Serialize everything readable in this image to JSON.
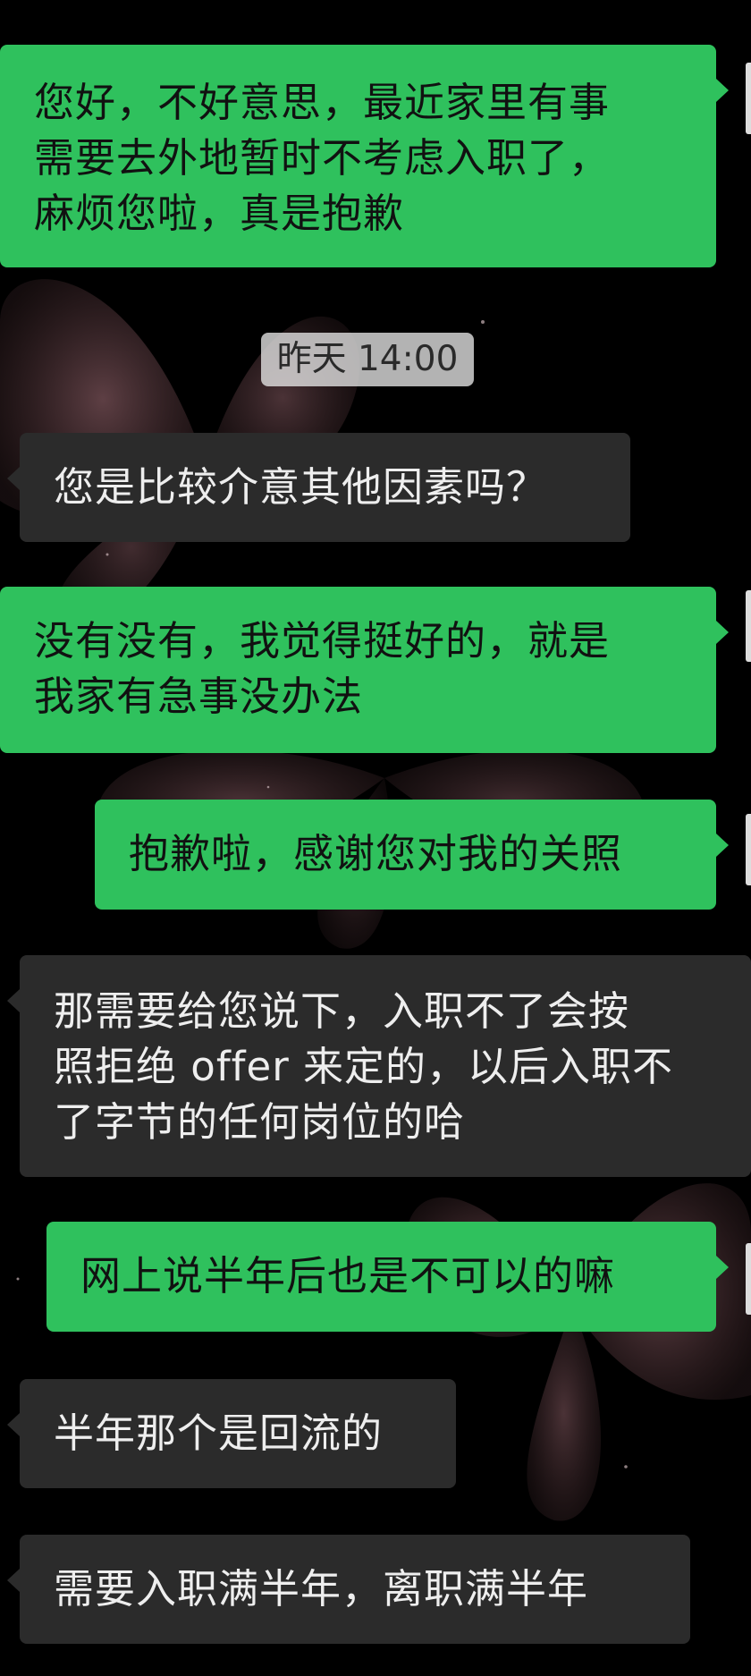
{
  "timestamp": "昨天 14:00",
  "messages": [
    {
      "side": "sent",
      "text": "您好，不好意思，最近家里有事\n需要去外地暂时不考虑入职了，\n麻烦您啦，真是抱歉"
    },
    {
      "side": "received",
      "text": "您是比较介意其他因素吗？"
    },
    {
      "side": "sent",
      "text": "没有没有，我觉得挺好的，就是\n我家有急事没办法"
    },
    {
      "side": "sent",
      "text": "抱歉啦，感谢您对我的关照"
    },
    {
      "side": "received",
      "text": "那需要给您说下，入职不了会按\n照拒绝 offer 来定的，以后入职不\n了字节的任何岗位的哈"
    },
    {
      "side": "sent",
      "text": "网上说半年后也是不可以的嘛"
    },
    {
      "side": "received",
      "text": "半年那个是回流的"
    },
    {
      "side": "received",
      "text": "需要入职满半年，离职满半年"
    }
  ],
  "colors": {
    "background": "#000000",
    "sent_bubble": "#2fc15d",
    "received_bubble": "#2b2b2b",
    "timestamp_bg": "#e6e6e6"
  }
}
